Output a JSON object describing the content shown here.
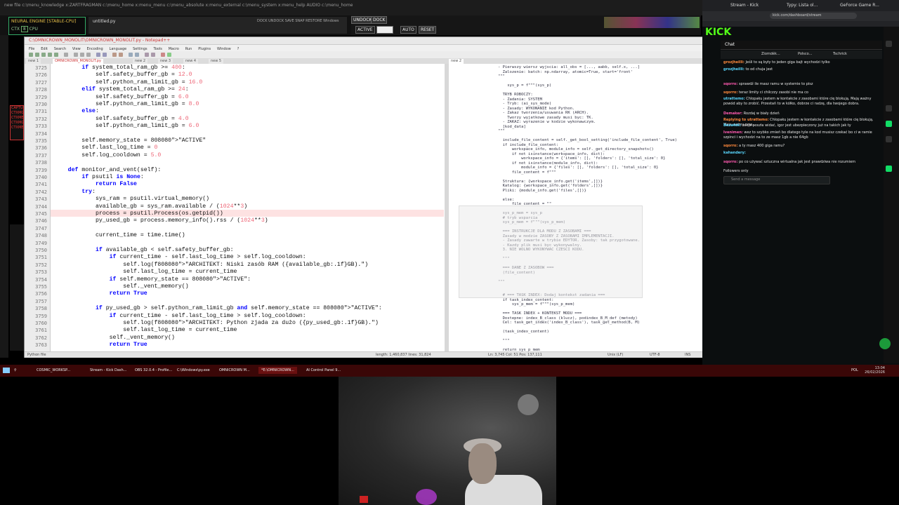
{
  "top_strip": {
    "text": "new file   c:\\menu_knowledge    x:ZARTFRAGMAN   c:\\menu_home   x:menu_menu   c:\\menu_absolute   x:menu_external   c:\\menu_system   x:menu_help   AUDIO   c:\\menu_home"
  },
  "engine": {
    "title": "NEURAL ENGINE [STABLE-CPU]",
    "ctx": "CTX",
    "cpu": "CPU",
    "val": "8"
  },
  "untitled_window": {
    "title": "untitled.py",
    "menu": "DOCK  UNDOCK  SAVE  SNAP  RESTORE  Windows"
  },
  "controls": {
    "undock": "UNDOCK",
    "dock": "DOCK",
    "activate": "ACTIVE",
    "auto": "AUTO",
    "reset": "RESET"
  },
  "left_labels": [
    "CAPTU",
    "CTXMG",
    "CTXME",
    "CTXMG",
    "CTXME"
  ],
  "editor": {
    "title": "C:\\OMNICROWN_MONOLIT\\OMNICROWN_MONOLIT.py - Notepad++",
    "menu": [
      "File",
      "Edit",
      "Search",
      "View",
      "Encoding",
      "Language",
      "Settings",
      "Tools",
      "Macro",
      "Run",
      "Plugins",
      "Window",
      "?"
    ],
    "tabs": [
      "new 1",
      "OMNICROWN_MONOLIT.py",
      "new 2",
      "new 3",
      "new 4",
      "new 5"
    ],
    "right_tab": "new 2",
    "left_lines": [
      {
        "n": "3725",
        "t": "        if system_total_ram_gb >= 400:"
      },
      {
        "n": "3726",
        "t": "            self.safety_buffer_gb = 12.0"
      },
      {
        "n": "3727",
        "t": "            self.python_ram_limit_gb = 16.0"
      },
      {
        "n": "3728",
        "t": "        elif system_total_ram_gb >= 24:"
      },
      {
        "n": "3729",
        "t": "            self.safety_buffer_gb = 6.0"
      },
      {
        "n": "3730",
        "t": "            self.python_ram_limit_gb = 8.0"
      },
      {
        "n": "3731",
        "t": "        else:"
      },
      {
        "n": "3732",
        "t": "            self.safety_buffer_gb = 4.0"
      },
      {
        "n": "3733",
        "t": "            self.python_ram_limit_gb = 6.0"
      },
      {
        "n": "3734",
        "t": ""
      },
      {
        "n": "3735",
        "t": "        self.memory_state = \"ACTIVE\""
      },
      {
        "n": "3736",
        "t": "        self.last_log_time = 0"
      },
      {
        "n": "3737",
        "t": "        self.log_cooldown = 5.0"
      },
      {
        "n": "3738",
        "t": ""
      },
      {
        "n": "3739",
        "t": "    def monitor_and_vent(self):"
      },
      {
        "n": "3740",
        "t": "        if psutil is None:"
      },
      {
        "n": "3741",
        "t": "            return False"
      },
      {
        "n": "3742",
        "t": "        try:"
      },
      {
        "n": "3743",
        "t": "            sys_ram = psutil.virtual_memory()"
      },
      {
        "n": "3744",
        "t": "            available_gb = sys_ram.available / (1024**3)"
      },
      {
        "n": "3745",
        "t": "            process = psutil.Process(os.getpid())"
      },
      {
        "n": "3746",
        "t": "            py_used_gb = process.memory_info().rss / (1024**3)"
      },
      {
        "n": "3747",
        "t": ""
      },
      {
        "n": "3748",
        "t": "            current_time = time.time()"
      },
      {
        "n": "3749",
        "t": ""
      },
      {
        "n": "3750",
        "t": "            if available_gb < self.safety_buffer_gb:"
      },
      {
        "n": "3751",
        "t": "                if current_time - self.last_log_time > self.log_cooldown:"
      },
      {
        "n": "3752",
        "t": "                    self.log(f\"ARCHITEKT: Niski zasób RAM ({available_gb:.1f}GB).\")"
      },
      {
        "n": "3753",
        "t": "                    self.last_log_time = current_time"
      },
      {
        "n": "3754",
        "t": "                if self.memory_state == \"ACTIVE\":"
      },
      {
        "n": "3755",
        "t": "                    self._vent_memory()"
      },
      {
        "n": "3756",
        "t": "                return True"
      },
      {
        "n": "3757",
        "t": ""
      },
      {
        "n": "3758",
        "t": "            if py_used_gb > self.python_ram_limit_gb and self.memory_state == \"ACTIVE\":"
      },
      {
        "n": "3759",
        "t": "                if current_time - self.last_log_time > self.log_cooldown:"
      },
      {
        "n": "3760",
        "t": "                    self.log(f\"ARCHITEKT: Python zjada za dużo ({py_used_gb:.1f}GB).\")"
      },
      {
        "n": "3761",
        "t": "                    self.last_log_time = current_time"
      },
      {
        "n": "3762",
        "t": "                self._vent_memory()"
      },
      {
        "n": "3763",
        "t": "                return True"
      }
    ],
    "right_lines": [
      "- Pierwszy wiersz wyjscia: all_obs = [..., aabb, self.x, ...]",
      "  Zalozenie: batch: np.ndarray, atomic=True, start='front'",
      "\"\"\"",
      "",
      "    sys_p = f\"\"\"(sys_p)",
      "",
      "  TRYB ROBOCZY:",
      "  - Zadania: SYSTEM",
      "  - Tryb: (ai_sys_mode)",
      "  - Zasady: WYKONANIE kod Python.",
      "  - Zakaz tworzenia/usuwania RK (ARCH).",
      "    Tworzy wyjatkowe zasady musi byc: TK.",
      "  - ZAKAZ: wyrazenie w kodzie wykonawczym.",
      "  [kod_data]",
      "\"\"\"",
      "",
      "  include_file_content = self._get_bool_setting('include_file_content', True)",
      "  if include_file_content:",
      "      workspace_info, module_info = self._get_directory_snapshots()",
      "      if not isinstance(workspace_info, dict):",
      "          workspace_info = {'items': [], 'folders': [], 'total_size': 0}",
      "      if not isinstance(module_info, dict):",
      "          module_info = {'files': [], 'folders': [], 'total_size': 0}",
      "      file_content = f\"\"\"",
      "",
      "  Struktura: {workspace_info.get('items',[])}",
      "  Katalog: {workspace_info.get('folders',[])}",
      "  Pliki: {module_info.get('files',[])}",
      "",
      "  else:",
      "      file_content = \"\"",
      "",
      "  sys_p_mem = sys_p",
      "  # tryb wsparcia",
      "  sys_p_mem = f\"\"\"(sys_p_mem)",
      "",
      "  === INSTRUKCJE DLA MODU Z ZASOBAMI ===",
      "  Zasady w modzie ZASOBY Z ZASOBAMI IMPLEMENTACJI.",
      "  - Zasady zawarte w trybie EDYTOR. Zasoby: tak przygotowane.",
      "  - Kazdy plik musi byc wykonywalny.",
      "  3. NIE WOLNO WYKONYWAC CZESCI KODU.",
      "",
      "  \"\"\"",
      "",
      "  === DANE Z ZASOBOW ===",
      "  (file_content)",
      "",
      "\"\"\"",
      "",
      "",
      "  # === TASK INDEX: Dodaj kontekst zadania ===",
      "  if task_index_content:",
      "      sys_p_mem = f\"\"\"(sys_p_mem)",
      "",
      "  === TASK INDEX + KONTEKST MODU ===",
      "  Dostepne: index_B_class (klucz), podindex_B_M_def (metody)",
      "  Cel: task_get_index('index_B_class'), task_get_method(B, M)",
      "",
      "  (task_index_content)",
      "",
      "  \"\"\"",
      "",
      "  return sys_p_mem"
    ],
    "status": {
      "type": "Python file",
      "length": "length: 1,460,837   lines: 31,824",
      "pos": "Ln: 3,745   Col: 51   Pos: 137,111",
      "eol": "Unix (LF)",
      "enc": "UTF-8",
      "ins": "INS"
    }
  },
  "browser": {
    "tabs": [
      "Stream - Kick",
      "Typy: Lista ol...",
      "GeForce Game R..."
    ],
    "url": "kick.com/dashboard/stream",
    "logo": "KICK",
    "chat_title": "Chat",
    "pinned": [
      "Ziomdék...",
      "Polsco...",
      "Tschrick"
    ],
    "messages": [
      {
        "user": "grozjheilli:",
        "text": "Jeśli to są były to jeden giga bajt wychodzi tylko"
      },
      {
        "user": "grozjheilli:",
        "text": "to od chuja jest"
      },
      {
        "user": "sqorro:",
        "text": "sprawdź ile masz ramu w systemie to pisz"
      },
      {
        "user": "sqorro:",
        "text": "teraz limity ci chilczzy zasobi nie ma co"
      },
      {
        "user": "utrattemo:",
        "text": "Chlopaku jestem w kontakcie z zasobami które cię blokują. Mają ważny powód aby to zrobić. Przestań to w kółko, dobrze ci radzę, dla twojego dobra."
      },
      {
        "user": "Demaker:",
        "text": "Rozdaj w biały dzień"
      },
      {
        "user": "Replying to utrattemo:",
        "text": "Chlopaku jestem w kontakcie z zasobami które cię blokują. Mają ważny pow..."
      },
      {
        "user": "Bezwłok:",
        "text": "wieja poszła widać, igor jest ubezpieczony już na takich jak ty"
      },
      {
        "user": "lvenimen:",
        "text": "wez to szybko zmień bo dlatego tyle na kod musisz czekać bo ci w ramie szpinci i wychodzi na to ze masz 1gb a nie 64gb"
      },
      {
        "user": "sqorro:",
        "text": "a ty masz 400 giga ramu?"
      },
      {
        "user": "kahandery:",
        "text": ""
      },
      {
        "user": "sqorro:",
        "text": "po co używać sztuczna wirtualna jak jest prawdziwa nie rozumiem"
      },
      {
        "user": "",
        "text": "Followers only"
      }
    ],
    "send_placeholder": "Send a message"
  },
  "taskbar": {
    "items": [
      "COSMIC_WORKSP...",
      "Stream - Kick Dash...",
      "OBS 32.0.4 - Profile...",
      "C:\\Windows\\py.exe",
      "OMNICROWN M...",
      "*E:\\OMNICROWN...",
      "AI Control Panel 9..."
    ],
    "lang": "POL",
    "time": "13:04",
    "date": "26/02/2026"
  }
}
